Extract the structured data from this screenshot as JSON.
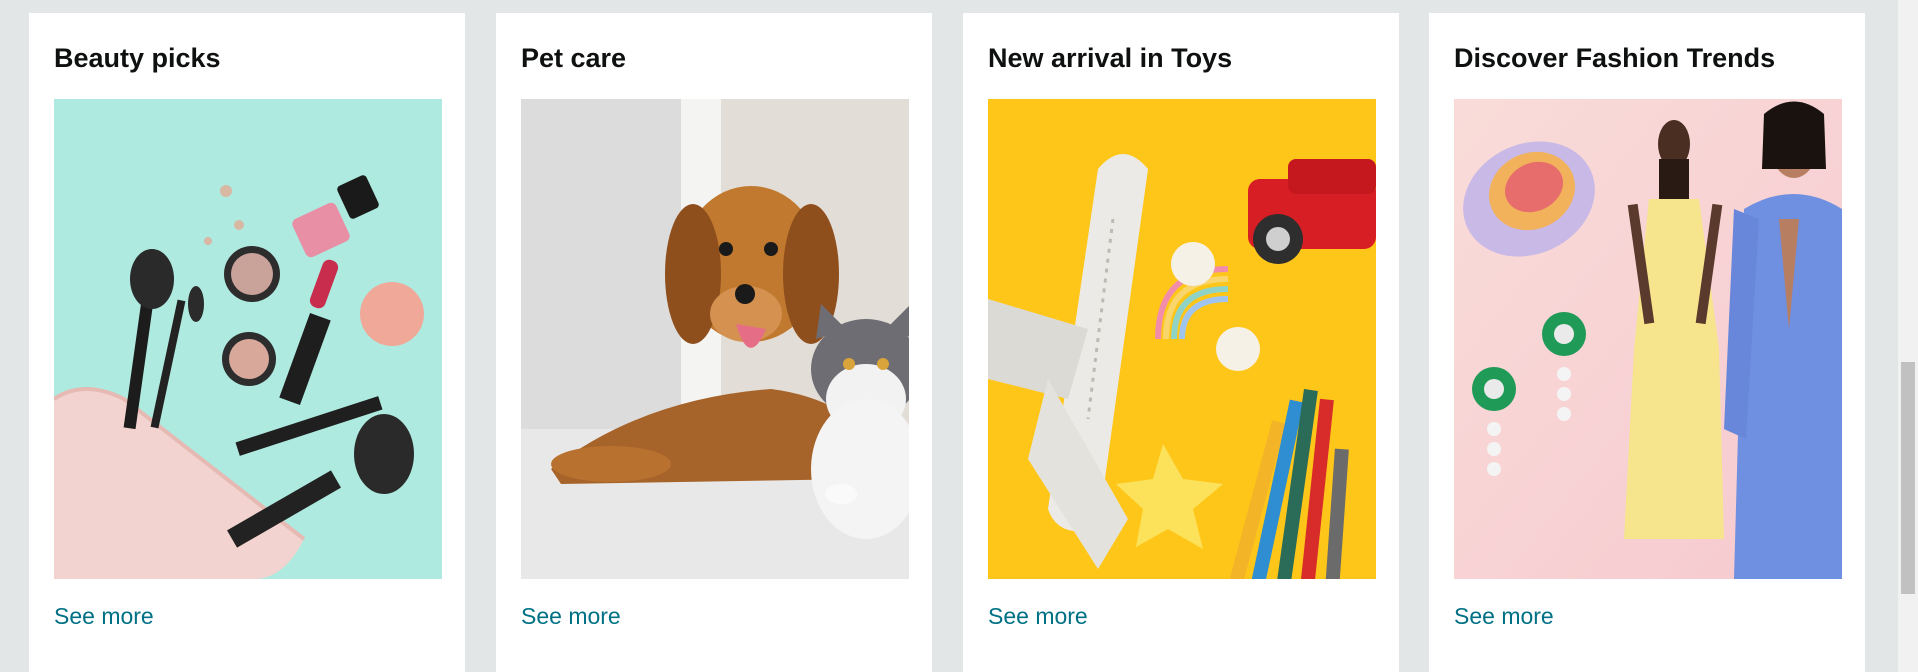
{
  "cards": [
    {
      "title": "Beauty picks",
      "link": "See more",
      "image": "makeup-flatlay"
    },
    {
      "title": "Pet care",
      "link": "See more",
      "image": "dog-and-cat"
    },
    {
      "title": "New arrival in Toys",
      "link": "See more",
      "image": "toys-flatlay"
    },
    {
      "title": "Discover Fashion Trends",
      "link": "See more",
      "image": "fashion-models"
    }
  ],
  "colors": {
    "page_background": "#e3e6e6",
    "card_background": "#ffffff",
    "title_text": "#0f1111",
    "link_text": "#007185"
  }
}
